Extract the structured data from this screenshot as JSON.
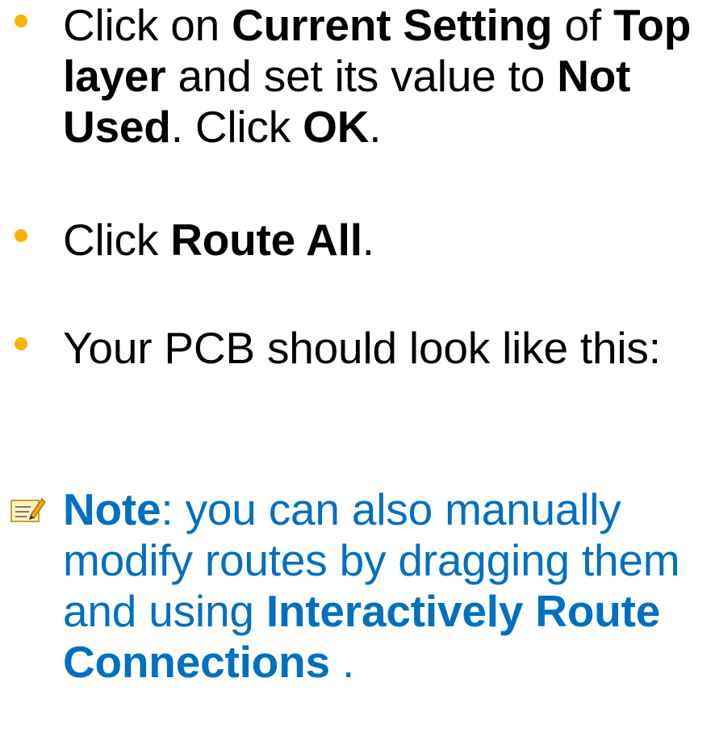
{
  "bullets": [
    {
      "parts": [
        {
          "t": "Click on ",
          "b": false
        },
        {
          "t": "Current Setting",
          "b": true
        },
        {
          "t": " of ",
          "b": false
        },
        {
          "t": "Top layer",
          "b": true
        },
        {
          "t": " and set its value to ",
          "b": false
        },
        {
          "t": "Not Used",
          "b": true
        },
        {
          "t": ". Click ",
          "b": false
        },
        {
          "t": "OK",
          "b": true
        },
        {
          "t": ".",
          "b": false
        }
      ]
    },
    {
      "parts": [
        {
          "t": "Click ",
          "b": false
        },
        {
          "t": "Route All",
          "b": true
        },
        {
          "t": ".",
          "b": false
        }
      ]
    },
    {
      "parts": [
        {
          "t": "Your PCB should look like this:",
          "b": false
        }
      ]
    }
  ],
  "note": {
    "icon": "note-pad-icon",
    "parts": [
      {
        "t": "Note",
        "b": true
      },
      {
        "t": ": you can also manually modify routes by dragging them and using ",
        "b": false
      },
      {
        "t": "Interactively Route Connections",
        "b": true
      },
      {
        "t": " .",
        "b": false
      }
    ]
  },
  "colors": {
    "bullet": "#f5b400",
    "note_text": "#0070c0",
    "body_text": "#000000"
  }
}
